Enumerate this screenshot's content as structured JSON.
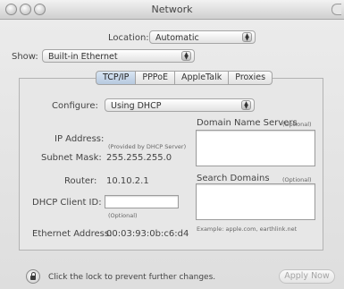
{
  "window": {
    "title": "Network"
  },
  "location": {
    "label": "Location:",
    "value": "Automatic"
  },
  "show": {
    "label": "Show:",
    "value": "Built-in Ethernet"
  },
  "tabs": [
    "TCP/IP",
    "PPPoE",
    "AppleTalk",
    "Proxies"
  ],
  "configure": {
    "label": "Configure:",
    "value": "Using DHCP"
  },
  "dns": {
    "label": "Domain Name Servers",
    "optional": "(Optional)"
  },
  "ip": {
    "label": "IP Address:",
    "note": "(Provided by DHCP Server)"
  },
  "subnet": {
    "label": "Subnet Mask:",
    "value": "255.255.255.0"
  },
  "router": {
    "label": "Router:",
    "value": "10.10.2.1"
  },
  "search_domains": {
    "label": "Search Domains",
    "optional": "(Optional)",
    "example": "Example: apple.com, earthlink.net"
  },
  "dhcp": {
    "label": "DHCP Client ID:",
    "optional": "(Optional)",
    "value": ""
  },
  "ethernet": {
    "label": "Ethernet Address:",
    "value": "00:03:93:0b:c6:d4"
  },
  "footer": {
    "lock_text": "Click the lock to prevent further changes.",
    "apply_label": "Apply Now"
  }
}
